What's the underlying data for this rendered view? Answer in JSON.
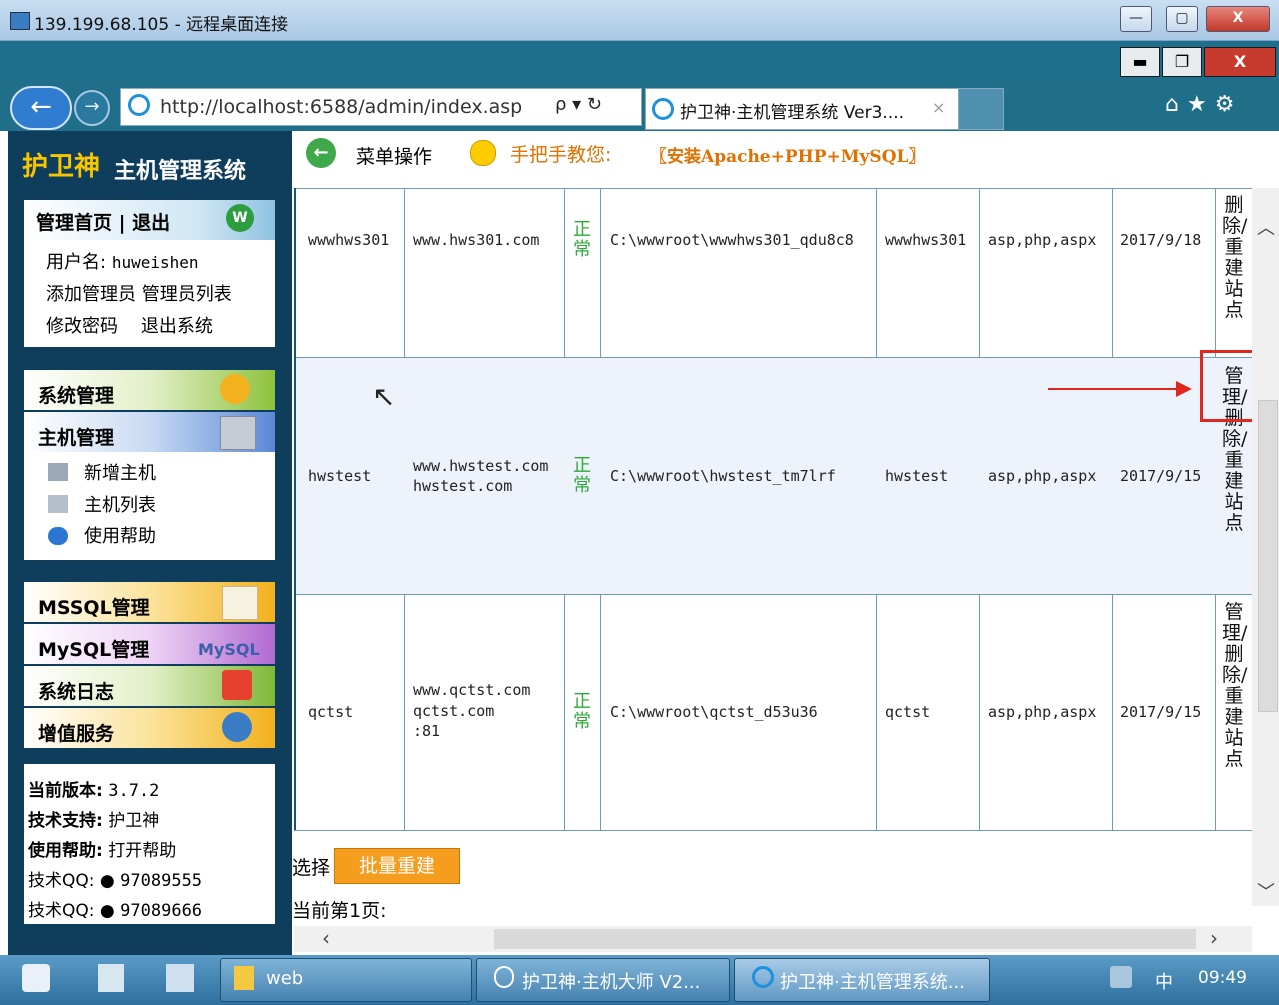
{
  "rdp": {
    "title": "139.199.68.105 - 远程桌面连接",
    "min": "—",
    "max": "▢",
    "close": "X"
  },
  "inner_window": {
    "min": "▬",
    "max": "❐",
    "close": "X"
  },
  "browser": {
    "url": "http://localhost:6588/admin/index.asp",
    "addr_controls": "ρ ▾ ↻",
    "tab_title": "护卫神·主机管理系统 Ver3....",
    "tab_close": "×",
    "right_icons": "⌂★⚙"
  },
  "sidebar": {
    "logo_main": "护卫神",
    "logo_sub": "主机管理系统",
    "head": "管理首页 | 退出",
    "username_label": "用户名:",
    "username": "huweishen",
    "links_row1": "添加管理员  管理员列表",
    "links_row2": "修改密码    退出系统",
    "menu": {
      "system": "系统管理",
      "host": "主机管理",
      "host_items": [
        "新增主机",
        "主机列表",
        "使用帮助"
      ],
      "mssql": "MSSQL管理",
      "mysql": "MySQL管理",
      "log": "系统日志",
      "vas": "增值服务"
    },
    "info": {
      "version_label": "当前版本:",
      "version": "3.7.2",
      "support_label": "技术支持:",
      "support": "护卫神",
      "help_label": "使用帮助:",
      "help": "打开帮助",
      "qq1_label": "技术QQ:",
      "qq1": "97089555",
      "qq2_label": "技术QQ:",
      "qq2": "97089666"
    }
  },
  "top_strip": {
    "menu_op": "菜单操作",
    "teach": "手把手教您:",
    "link": "〖安装Apache+PHP+MySQL〗"
  },
  "table": {
    "rows": [
      {
        "name": "wwwhws301",
        "domains": [
          "www.hws301.com"
        ],
        "status": "正常",
        "path": "C:\\wwwroot\\wwwhws301_qdu8c8",
        "user": "wwwhws301",
        "lang": "asp,php,aspx",
        "date": "2017/9/18",
        "action": "删除/重建站点"
      },
      {
        "name": "hwstest",
        "domains": [
          "www.hwstest.com",
          "hwstest.com"
        ],
        "status": "正常",
        "path": "C:\\wwwroot\\hwstest_tm7lrf",
        "user": "hwstest",
        "lang": "asp,php,aspx",
        "date": "2017/9/15",
        "action": "管理/删除/重建站点"
      },
      {
        "name": "qctst",
        "domains": [
          "www.qctst.com",
          "qctst.com",
          ":81"
        ],
        "status": "正常",
        "path": "C:\\wwwroot\\qctst_d53u36",
        "user": "qctst",
        "lang": "asp,php,aspx",
        "date": "2017/9/15",
        "action": "管理/删除/重建站点"
      }
    ]
  },
  "footer": {
    "select_label": "选择",
    "batch_button": "批量重建",
    "page_info": "当前第1页:"
  },
  "taskbar": {
    "items": [
      "web",
      "护卫神·主机大师 V2...",
      "护卫神·主机管理系统..."
    ],
    "ime": "中",
    "clock": "09:49"
  }
}
